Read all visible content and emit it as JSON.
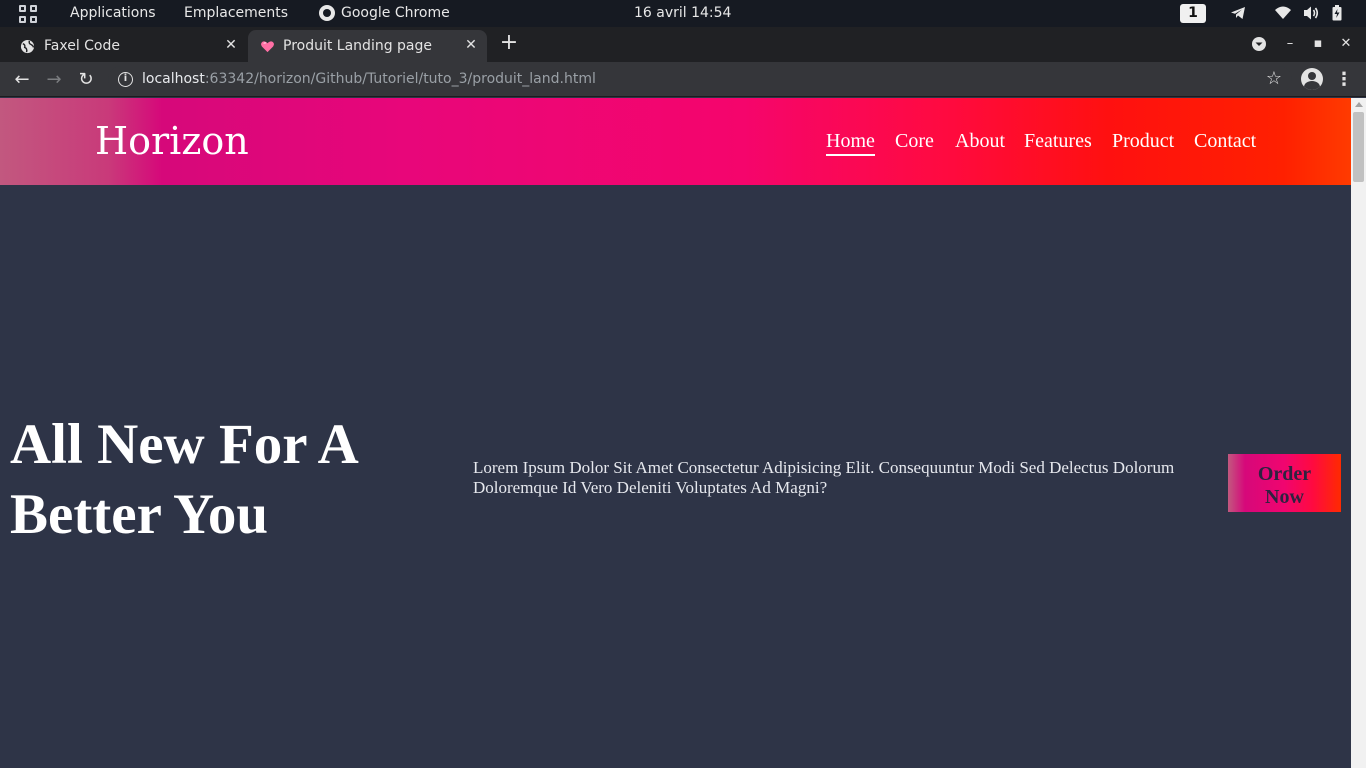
{
  "os_bar": {
    "applications": "Applications",
    "places": "Emplacements",
    "active_app": "Google Chrome",
    "clock": "16 avril  14:54",
    "workspace": "1",
    "tray_icons": [
      "telegram-icon",
      "wifi-icon",
      "volume-icon",
      "battery-icon"
    ]
  },
  "browser": {
    "tabs": [
      {
        "title": "Faxel Code",
        "favicon": "globe-icon",
        "active": false
      },
      {
        "title": "Produit Landing page",
        "favicon": "heart-icon",
        "active": true
      }
    ],
    "url_host": "localhost",
    "url_rest": ":63342/horizon/Github/Tutoriel/tuto_3/produit_land.html"
  },
  "site": {
    "brand": "Horizon",
    "nav": [
      "Home",
      "Core",
      "About",
      "Features",
      "Product",
      "Contact"
    ],
    "active_nav": "Home",
    "hero_line1": "All New For A",
    "hero_line2": "Better You",
    "hero_text": "Lorem Ipsum Dolor Sit Amet Consectetur Adipisicing Elit. Consequuntur Modi Sed Delectus Dolorum Doloremque Id Vero Deleniti Voluptates Ad Magni?",
    "cta_line1": "Order",
    "cta_line2": "Now"
  },
  "colors": {
    "page_bg": "#2e3447",
    "header_gradient_start": "#c2587f",
    "header_gradient_mid": "#e8067a",
    "header_gradient_end": "#ff3b00"
  }
}
